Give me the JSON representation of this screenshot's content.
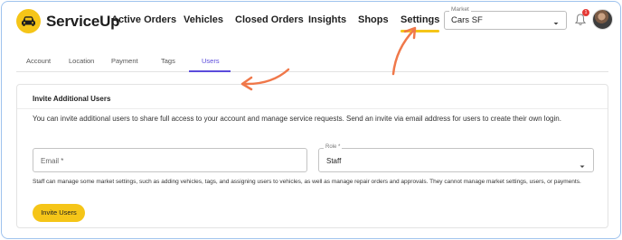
{
  "app": {
    "name": "ServiceUp"
  },
  "nav": {
    "items": [
      {
        "label": "Active Orders"
      },
      {
        "label": "Vehicles"
      },
      {
        "label": "Closed Orders"
      },
      {
        "label": "Insights"
      },
      {
        "label": "Shops"
      },
      {
        "label": "Settings",
        "active": true
      }
    ]
  },
  "market": {
    "label": "Market",
    "value": "Cars SF"
  },
  "notifications": {
    "count": "1"
  },
  "tabs": [
    {
      "label": "Account"
    },
    {
      "label": "Location"
    },
    {
      "label": "Payment"
    },
    {
      "label": "Tags"
    },
    {
      "label": "Users",
      "active": true
    }
  ],
  "invite": {
    "title": "Invite Additional Users",
    "description": "You can invite additional users to share full access to your account and manage service requests. Send an invite via email address for users to create their own login.",
    "email_placeholder": "Email *",
    "role_label": "Role *",
    "role_value": "Staff",
    "helper": "Staff can manage some market settings, such as adding vehicles, tags, and assigning users to vehicles, as well as manage repair orders and approvals. They cannot manage market settings, users, or payments.",
    "button_label": "Invite Users"
  },
  "colors": {
    "brand": "#f5c518",
    "tab_active": "#5b4bdb",
    "annotation_arrow": "#f0784a",
    "frame_border": "#9fc3ee"
  }
}
